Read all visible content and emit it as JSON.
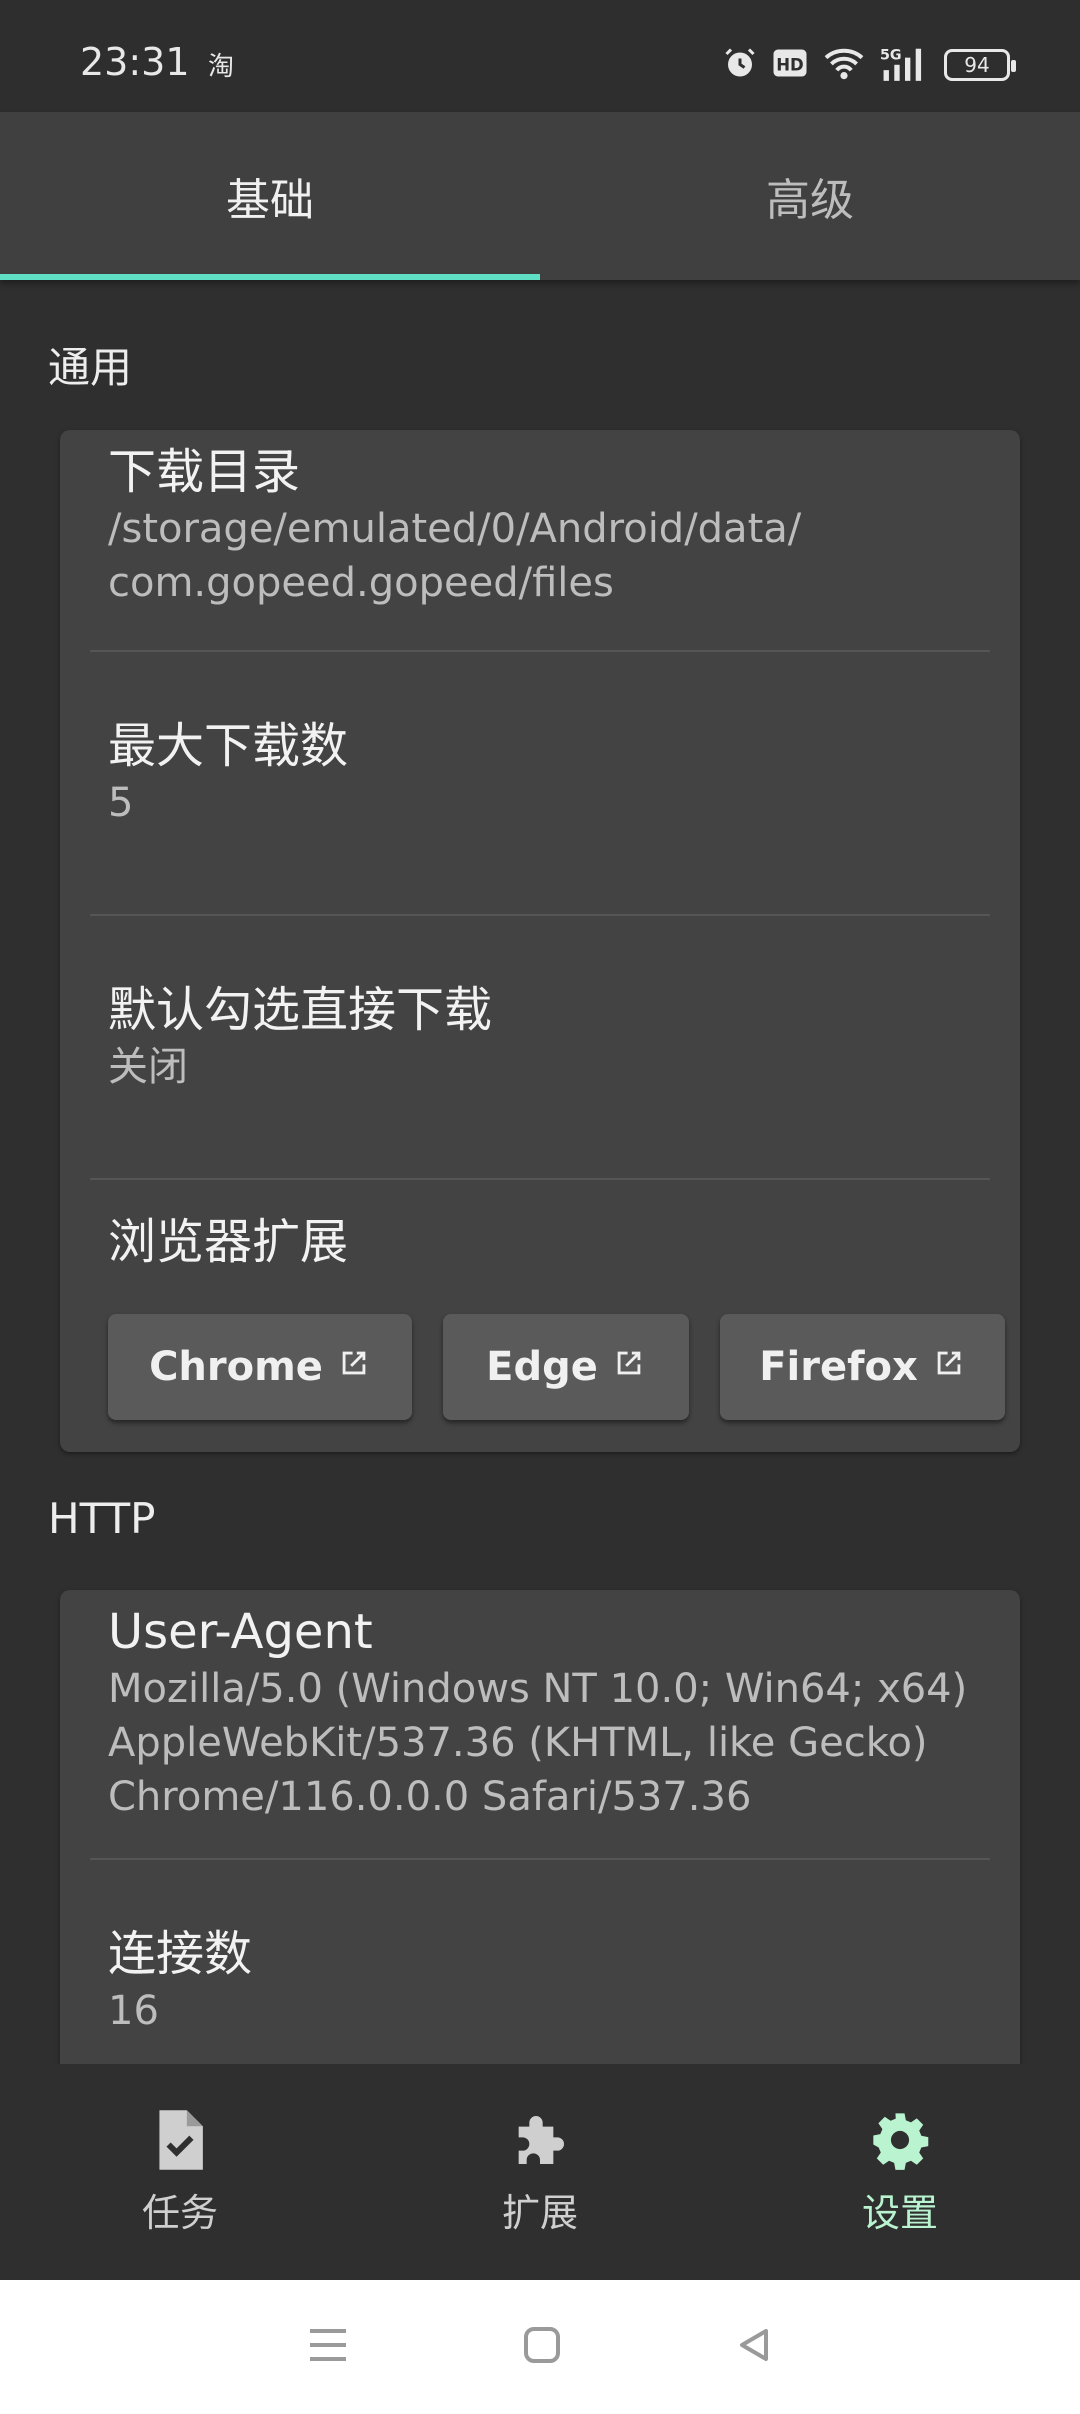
{
  "status_bar": {
    "time": "23:31",
    "app_indicator": "淘",
    "battery": "94",
    "icons": [
      "alarm-icon",
      "hd-icon",
      "wifi-icon",
      "5g-signal-icon",
      "battery-icon"
    ]
  },
  "tabs": [
    {
      "label": "基础",
      "active": true
    },
    {
      "label": "高级",
      "active": false
    }
  ],
  "sections": {
    "general": {
      "title": "通用",
      "download_dir": {
        "title": "下载目录",
        "value": "/storage/emulated/0/Android/data/\ncom.gopeed.gopeed/files"
      },
      "max_downloads": {
        "title": "最大下载数",
        "value": "5"
      },
      "auto_select": {
        "title": "默认勾选直接下载",
        "value": "关闭"
      },
      "browser_ext": {
        "title": "浏览器扩展",
        "buttons": [
          "Chrome",
          "Edge",
          "Firefox"
        ]
      }
    },
    "http": {
      "title": "HTTP",
      "user_agent": {
        "title": "User-Agent",
        "value": "Mozilla/5.0 (Windows NT 10.0; Win64; x64)\nAppleWebKit/537.36 (KHTML, like Gecko)\nChrome/116.0.0.0 Safari/537.36"
      },
      "connections": {
        "title": "连接数",
        "value": "16"
      }
    }
  },
  "bottom_nav": [
    {
      "label": "任务",
      "icon": "task-file-check-icon",
      "active": false
    },
    {
      "label": "扩展",
      "icon": "puzzle-icon",
      "active": false
    },
    {
      "label": "设置",
      "icon": "gear-icon",
      "active": true
    }
  ],
  "colors": {
    "accent": "#5fe0c4",
    "active_nav": "#b9f3cf",
    "background": "#2f2f2f",
    "card": "#434343"
  }
}
